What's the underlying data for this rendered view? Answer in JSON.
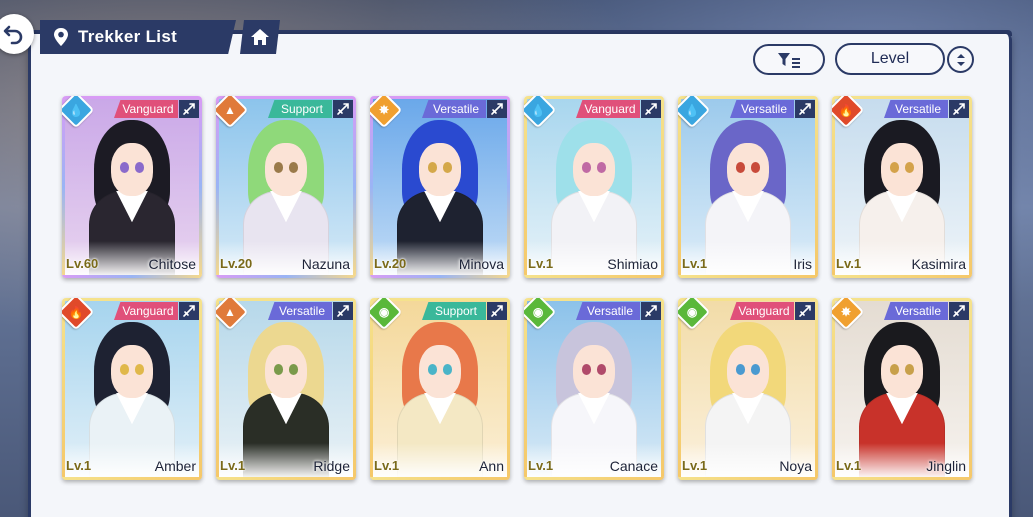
{
  "header": {
    "title": "Trekker List",
    "sort_label": "Level"
  },
  "colors": {
    "navy": "#2b3a66",
    "panel": "#f4f6fa"
  },
  "icons": {
    "back": "back-arrow-icon",
    "location": "map-pin-icon",
    "home": "home-icon",
    "filter": "filter-icon",
    "order": "sort-order-icon"
  },
  "trekkers": [
    {
      "name": "Chitose",
      "level": "Lv.60",
      "class": "Vanguard",
      "element": "water",
      "rarity": 5,
      "hair": "#1c1b24",
      "eyes": "#8a6acb",
      "outfit": "#2a2630",
      "sky": [
        "#caa8e8",
        "#e8d4ef"
      ]
    },
    {
      "name": "Nazuna",
      "level": "Lv.20",
      "class": "Support",
      "element": "earth",
      "rarity": 5,
      "hair": "#8fd97a",
      "eyes": "#9a7a4a",
      "outfit": "#e8e4f0",
      "sky": [
        "#8cc4ec",
        "#d6eaf7"
      ]
    },
    {
      "name": "Minova",
      "level": "Lv.20",
      "class": "Versatile",
      "element": "light",
      "rarity": 5,
      "hair": "#2a4ad0",
      "eyes": "#d4a84a",
      "outfit": "#1e2230",
      "sky": [
        "#6aa8ea",
        "#c2dcf6"
      ]
    },
    {
      "name": "Shimiao",
      "level": "Lv.1",
      "class": "Vanguard",
      "element": "water",
      "rarity": 4,
      "hair": "#9ee0ea",
      "eyes": "#c06aa4",
      "outfit": "#f2f2f6",
      "sky": [
        "#a8d6ee",
        "#e6f2f8"
      ]
    },
    {
      "name": "Iris",
      "level": "Lv.1",
      "class": "Versatile",
      "element": "water",
      "rarity": 4,
      "hair": "#6a66c8",
      "eyes": "#c84a3a",
      "outfit": "#f4f4f8",
      "sky": [
        "#9ccaec",
        "#dcecf8"
      ]
    },
    {
      "name": "Kasimira",
      "level": "Lv.1",
      "class": "Versatile",
      "element": "fire",
      "rarity": 4,
      "hair": "#1a1a22",
      "eyes": "#d4a24a",
      "outfit": "#f6f0ec",
      "sky": [
        "#c6dcee",
        "#eef4f8"
      ]
    },
    {
      "name": "Amber",
      "level": "Lv.1",
      "class": "Vanguard",
      "element": "fire",
      "rarity": 4,
      "hair": "#1e2232",
      "eyes": "#e0b84a",
      "outfit": "#eaf2f6",
      "sky": [
        "#a6d4ee",
        "#e2f0f8"
      ]
    },
    {
      "name": "Ridge",
      "level": "Lv.1",
      "class": "Versatile",
      "element": "earth",
      "rarity": 4,
      "hair": "#ecd890",
      "eyes": "#7a9a4a",
      "outfit": "#2a2e26",
      "sky": [
        "#b6d8ea",
        "#eaf2f6"
      ]
    },
    {
      "name": "Ann",
      "level": "Lv.1",
      "class": "Support",
      "element": "wind",
      "rarity": 4,
      "hair": "#e8784a",
      "eyes": "#4ab4c8",
      "outfit": "#f4e8c4",
      "sky": [
        "#f4d89a",
        "#fbefd6"
      ]
    },
    {
      "name": "Canace",
      "level": "Lv.1",
      "class": "Versatile",
      "element": "wind",
      "rarity": 4,
      "hair": "#c8c4dc",
      "eyes": "#b04a6a",
      "outfit": "#f6f6fa",
      "sky": [
        "#8cc2ea",
        "#d8eaf6"
      ]
    },
    {
      "name": "Noya",
      "level": "Lv.1",
      "class": "Vanguard",
      "element": "wind",
      "rarity": 4,
      "hair": "#f2d87a",
      "eyes": "#4a9ad0",
      "outfit": "#f4f4f4",
      "sky": [
        "#f2dca8",
        "#fbf0dc"
      ]
    },
    {
      "name": "Jinglin",
      "level": "Lv.1",
      "class": "Versatile",
      "element": "light",
      "rarity": 4,
      "hair": "#1a1a1e",
      "eyes": "#c8a04a",
      "outfit": "#c8322a",
      "sky": [
        "#e4dcd2",
        "#f6f2ee"
      ]
    }
  ]
}
